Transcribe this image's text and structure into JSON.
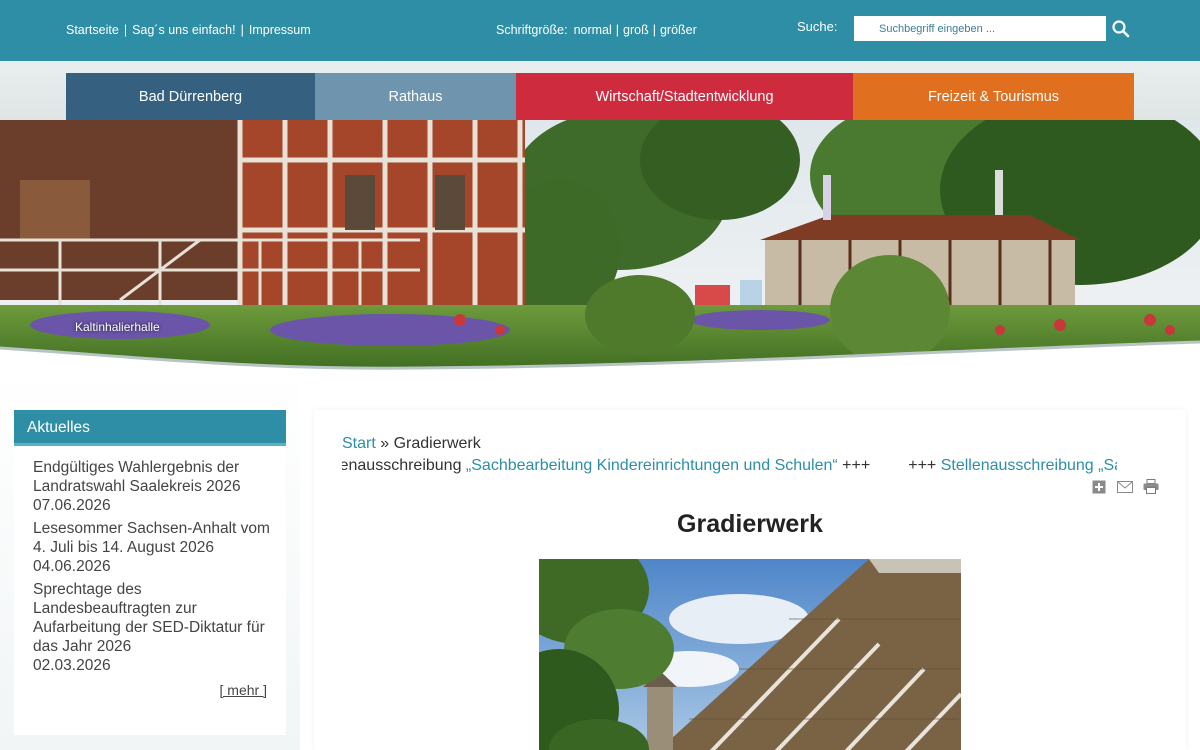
{
  "top": {
    "links": [
      "Startseite",
      "Sag´s uns einfach!",
      "Impressum"
    ],
    "fontsize_label": "Schriftgröße:",
    "fontsize_options": [
      "normal",
      "groß",
      "größer"
    ],
    "search_label": "Suche:",
    "search_placeholder": "Suchbegriff eingeben ..."
  },
  "nav": [
    "Bad Dürrenberg",
    "Rathaus",
    "Wirtschaft/Stadtentwicklung",
    "Freizeit & Tourismus"
  ],
  "colors": {
    "topbar": "#2d8ea6",
    "nav1": "#35607f",
    "nav2": "#6f94ad",
    "nav3": "#cf2b3f",
    "nav4": "#e07020"
  },
  "hero": {
    "caption": "Kaltinhalierhalle"
  },
  "sidebar": {
    "title": "Aktuelles",
    "items": [
      {
        "title": "Endgültiges Wahlergebnis der Landratswahl Saalekreis 2026",
        "date": "07.06.2026"
      },
      {
        "title": "Lesesommer Sachsen-Anhalt vom 4. Juli bis 14. August 2026",
        "date": "04.06.2026"
      },
      {
        "title": "Sprechtage des Landesbeauftragten zur Aufarbeitung der SED-Diktatur für das Jahr 2026",
        "date": "02.03.2026"
      }
    ],
    "more": "[ mehr ]"
  },
  "main": {
    "breadcrumb_link": "Start",
    "breadcrumb_sep": "»",
    "breadcrumb_current": "Gradierwerk",
    "ticker_prefix": "+++ Stellenausschreibung ",
    "ticker_link": "„Sachbearbeitung Kindereinrichtungen und Schulen“",
    "ticker_suffix": " +++",
    "ticker_repeat_prefix": "+++ ",
    "ticker_repeat_link": "Stellenausschreibung „Sachbearbeitung Kindereinrichtungen und Schulen“",
    "page_title": "Gradierwerk"
  },
  "icons": [
    "add-icon",
    "email-icon",
    "print-icon",
    "search-icon"
  ]
}
